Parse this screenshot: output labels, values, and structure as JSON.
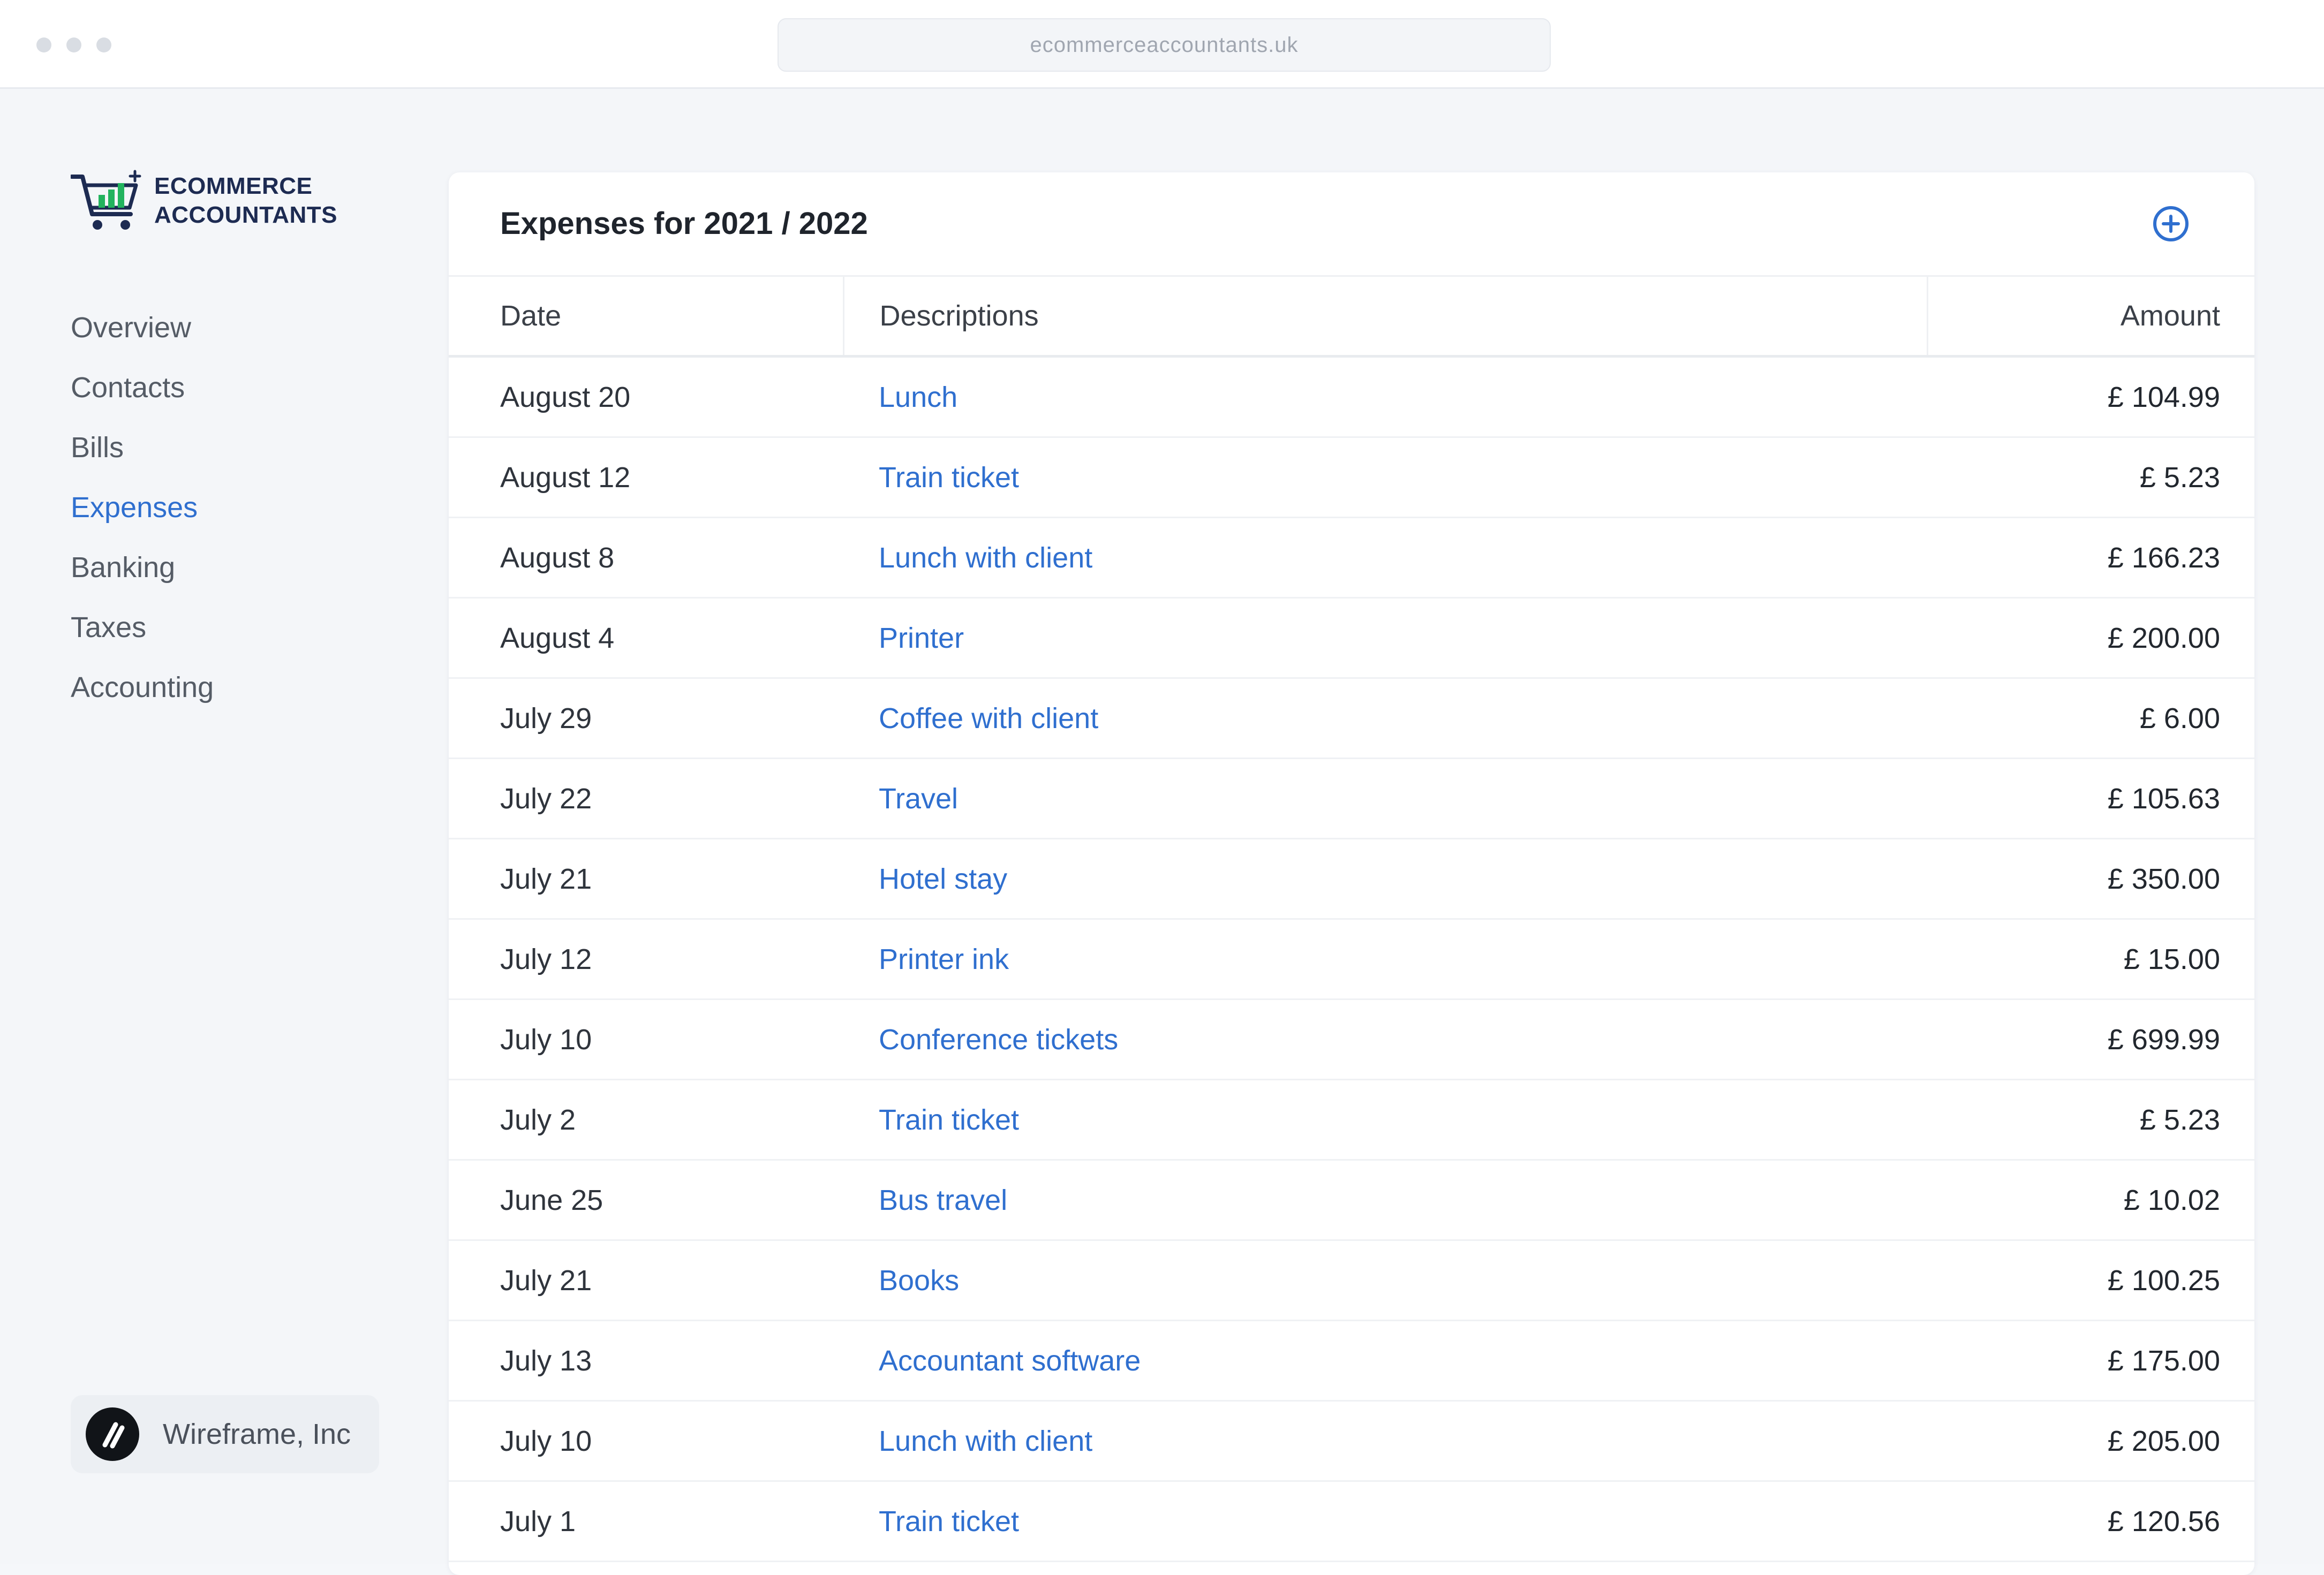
{
  "browser": {
    "url": "ecommerceaccountants.uk"
  },
  "brand": {
    "line1": "ECOMMERCE",
    "line2": "ACCOUNTANTS"
  },
  "sidebar": {
    "items": [
      {
        "label": "Overview"
      },
      {
        "label": "Contacts"
      },
      {
        "label": "Bills"
      },
      {
        "label": "Expenses"
      },
      {
        "label": "Banking"
      },
      {
        "label": "Taxes"
      },
      {
        "label": "Accounting"
      }
    ],
    "active": "Expenses",
    "company": "Wireframe, Inc"
  },
  "expenses": {
    "title": "Expenses for 2021 / 2022",
    "columns": {
      "date": "Date",
      "description": "Descriptions",
      "amount": "Amount"
    },
    "rows": [
      {
        "date": "August 20",
        "description": "Lunch",
        "amount": "£ 104.99"
      },
      {
        "date": "August 12",
        "description": "Train ticket",
        "amount": "£ 5.23"
      },
      {
        "date": "August 8",
        "description": "Lunch with client",
        "amount": "£ 166.23"
      },
      {
        "date": "August 4",
        "description": "Printer",
        "amount": "£ 200.00"
      },
      {
        "date": "July 29",
        "description": "Coffee with client",
        "amount": "£ 6.00"
      },
      {
        "date": "July 22",
        "description": "Travel",
        "amount": "£ 105.63"
      },
      {
        "date": "July 21",
        "description": "Hotel stay",
        "amount": "£ 350.00"
      },
      {
        "date": "July 12",
        "description": "Printer ink",
        "amount": "£ 15.00"
      },
      {
        "date": "July 10",
        "description": "Conference tickets",
        "amount": "£ 699.99"
      },
      {
        "date": "July 2",
        "description": "Train ticket",
        "amount": "£ 5.23"
      },
      {
        "date": "June 25",
        "description": "Bus travel",
        "amount": "£ 10.02"
      },
      {
        "date": "July 21",
        "description": "Books",
        "amount": "£ 100.25"
      },
      {
        "date": "July 13",
        "description": "Accountant software",
        "amount": "£ 175.00"
      },
      {
        "date": "July 10",
        "description": "Lunch with client",
        "amount": "£ 205.00"
      },
      {
        "date": "July 1",
        "description": "Train ticket",
        "amount": "£ 120.56"
      }
    ]
  },
  "colors": {
    "accent": "#2f6fcf",
    "brand_navy": "#1d2b52",
    "brand_green": "#22b35e"
  },
  "icons": {
    "add": "plus-circle-icon",
    "logo": "shopping-cart-chart-icon",
    "company": "slash-logo-icon"
  }
}
